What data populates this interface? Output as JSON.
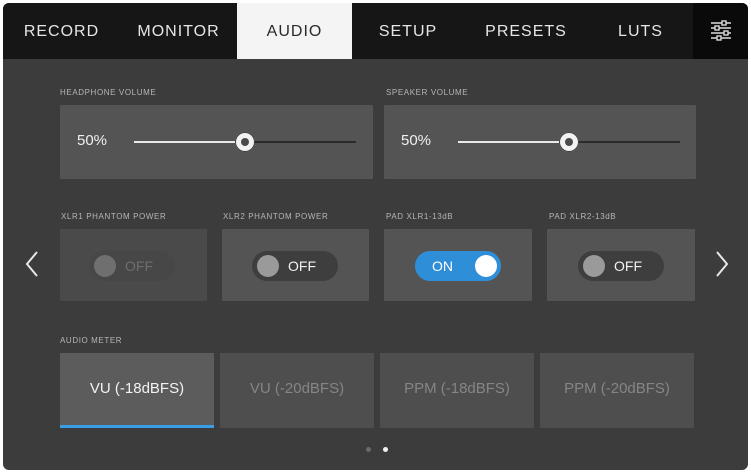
{
  "tabs": [
    {
      "label": "RECORD",
      "active": false
    },
    {
      "label": "MONITOR",
      "active": false
    },
    {
      "label": "AUDIO",
      "active": true
    },
    {
      "label": "SETUP",
      "active": false
    },
    {
      "label": "PRESETS",
      "active": false
    },
    {
      "label": "LUTS",
      "active": false
    }
  ],
  "settings_icon": "sliders-icon",
  "volume": {
    "headphone": {
      "label": "HEADPHONE VOLUME",
      "value": "50%",
      "level": 0.5
    },
    "speaker": {
      "label": "SPEAKER VOLUME",
      "value": "50%",
      "level": 0.5
    }
  },
  "toggles": [
    {
      "label": "XLR1 PHANTOM POWER",
      "state": "OFF",
      "on": false,
      "enabled": false
    },
    {
      "label": "XLR2 PHANTOM POWER",
      "state": "OFF",
      "on": false,
      "enabled": true
    },
    {
      "label": "PAD XLR1-13dB",
      "state": "ON",
      "on": true,
      "enabled": true
    },
    {
      "label": "PAD XLR2-13dB",
      "state": "OFF",
      "on": false,
      "enabled": true
    }
  ],
  "audio_meter": {
    "label": "AUDIO METER",
    "options": [
      "VU (-18dBFS)",
      "VU (-20dBFS)",
      "PPM (-18dBFS)",
      "PPM (-20dBFS)"
    ],
    "selected_index": 0
  },
  "pagination": {
    "pages": 2,
    "current": 2
  },
  "colors": {
    "accent": "#2f8ed8",
    "selection_underline": "#3a9ee6",
    "background": "#3c3c3c",
    "tabbar": "#161616"
  }
}
